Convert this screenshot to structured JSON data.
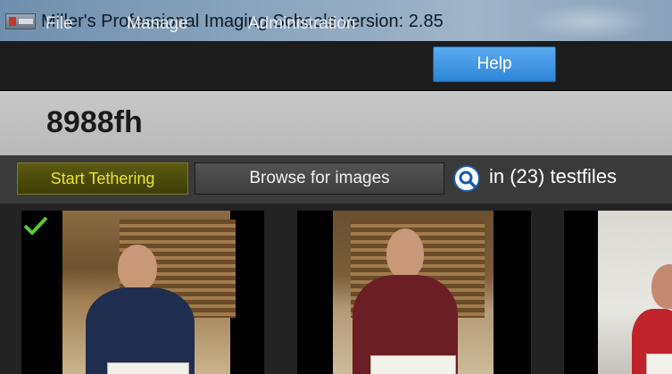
{
  "window": {
    "title": "Miller's Professional Imaging Schools version: 2.85"
  },
  "menu": {
    "items": [
      {
        "label": "File"
      },
      {
        "label": "Manage"
      },
      {
        "label": "Administration"
      },
      {
        "label": "Help"
      }
    ],
    "active": "Help"
  },
  "header": {
    "code": "8988fh"
  },
  "toolbar": {
    "tether_label": "Start Tethering",
    "browse_label": "Browse for images",
    "search_icon": "search-icon",
    "search_result": "in (23) testfiles"
  },
  "gallery": {
    "thumbnails": [
      {
        "selected": true,
        "icon": "check-icon"
      },
      {
        "selected": false
      },
      {
        "selected": false
      }
    ]
  },
  "colors": {
    "accent_help": "#3d93e0",
    "tether_text": "#e9e433",
    "check": "#5cc93a"
  }
}
